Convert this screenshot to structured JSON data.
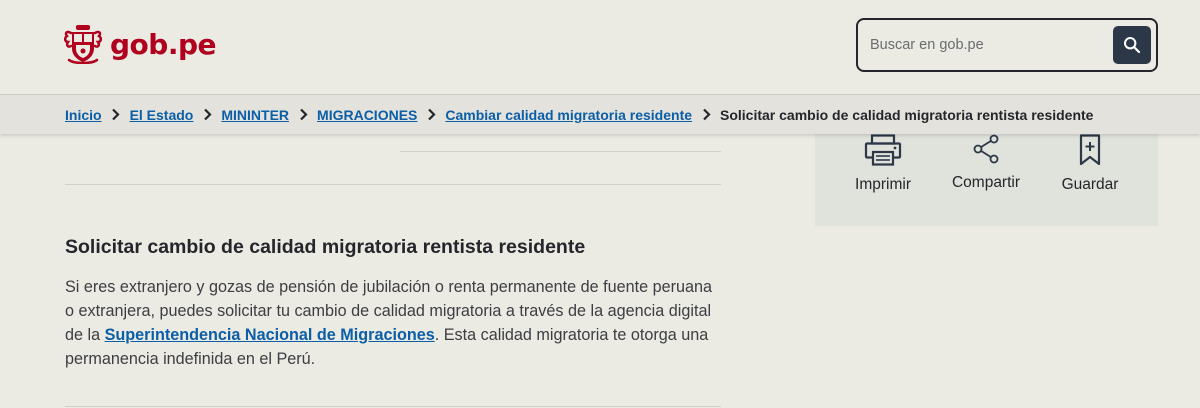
{
  "header": {
    "logo_text": "gob.pe",
    "search": {
      "placeholder": "Buscar en gob.pe"
    }
  },
  "breadcrumb": [
    {
      "label": "Inicio",
      "link": true
    },
    {
      "label": "El Estado",
      "link": true
    },
    {
      "label": "MININTER",
      "link": true
    },
    {
      "label": "MIGRACIONES",
      "link": true
    },
    {
      "label": "Cambiar calidad migratoria residente",
      "link": true
    },
    {
      "label": "Solicitar cambio de calidad migratoria rentista residente",
      "link": false
    }
  ],
  "actions": {
    "print": "Imprimir",
    "share": "Compartir",
    "save": "Guardar"
  },
  "content": {
    "title": "Solicitar cambio de calidad migratoria rentista residente",
    "para_before": "Si eres extranjero y gozas de pensión de jubilación o renta permanente de fuente peruana o extranjera, puedes solicitar tu cambio de calidad migratoria a través de la agencia digital de la ",
    "para_link": "Superintendencia Nacional de Migraciones",
    "para_after": ". Esta calidad migratoria te otorga una permanencia indefinida en el Perú."
  },
  "colors": {
    "brand_red": "#b0001e",
    "link_blue": "#0b5ea8",
    "search_button": "#2c3848",
    "background": "#ebeae3"
  }
}
